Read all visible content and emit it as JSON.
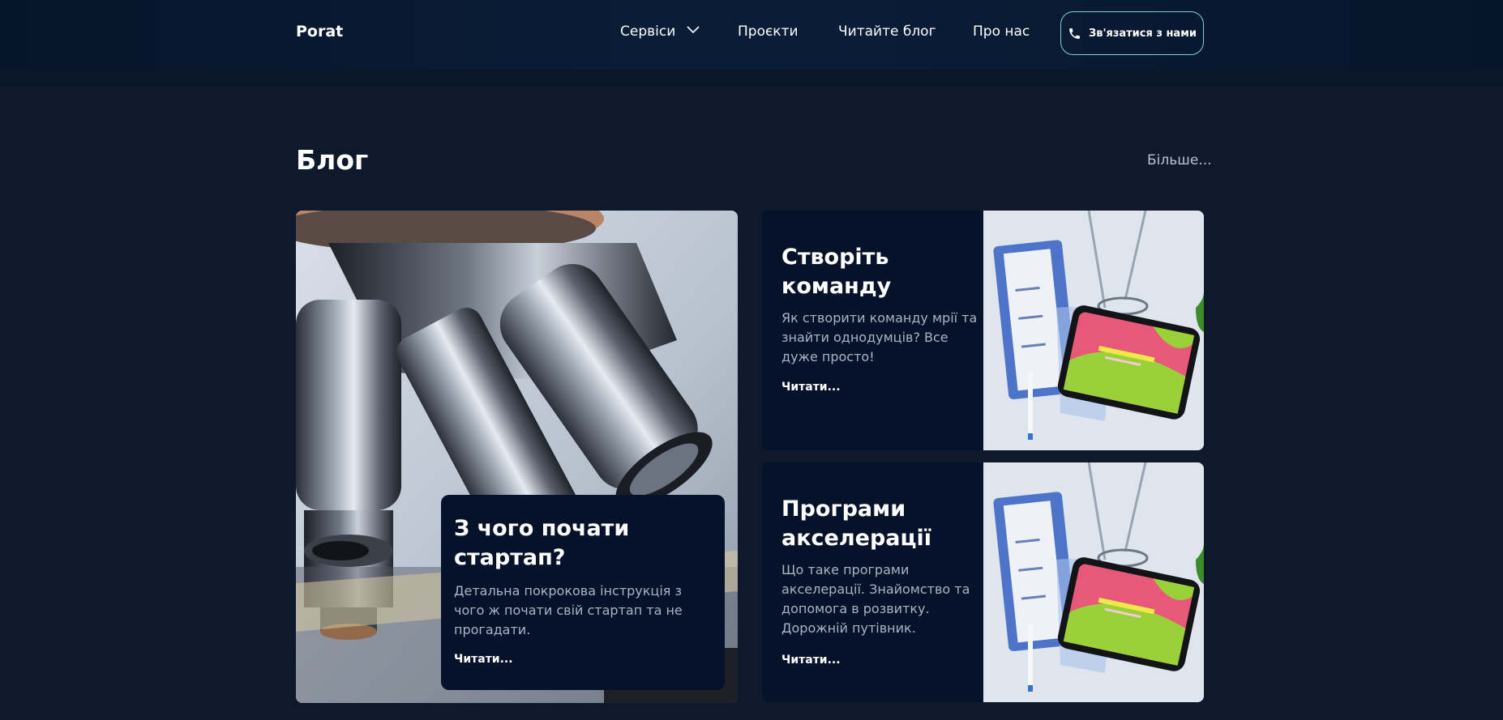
{
  "header": {
    "logo": "Porat",
    "nav": {
      "services": "Сервіси",
      "projects": "Проєкти",
      "blog": "Читайте блог",
      "about": "Про нас"
    },
    "contact_label": "Зв'язатися з нами"
  },
  "blog": {
    "title": "Блог",
    "more": "Більше...",
    "cards": [
      {
        "title": "З чого почати стартап?",
        "description": "Детальна покрокова інструкція з чого ж почати свій стартап та не прогадати.",
        "read": "Читати..."
      },
      {
        "title": "Створіть команду",
        "description": "Як створити команду мрії та знайти однодумців? Все дуже просто!",
        "read": "Читати..."
      },
      {
        "title": "Програми акселерації",
        "description": "Що таке програми акселерації. Знайомство та допомога в розвитку. Дорожній путівник.",
        "read": "Читати..."
      }
    ]
  },
  "colors": {
    "background": "#0e1a2c",
    "header": "#07152a",
    "card": "#05122a",
    "accent_border": "#7fd3cc"
  },
  "icons": [
    "chevron-down-icon",
    "phone-icon"
  ]
}
